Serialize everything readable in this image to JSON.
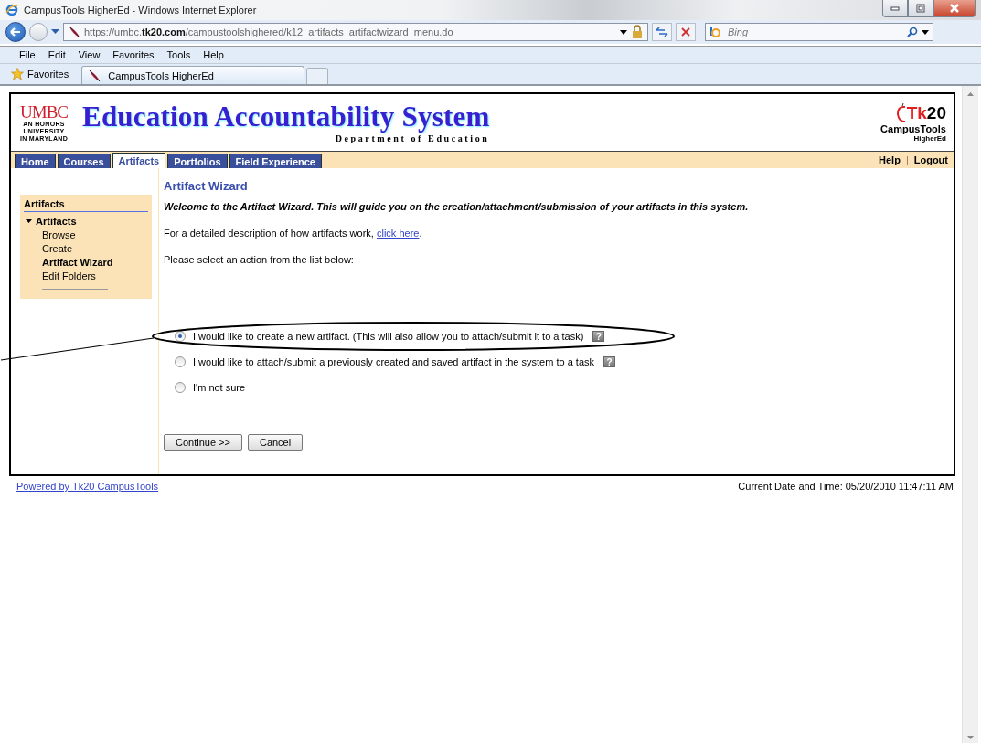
{
  "window": {
    "title": "CampusTools HigherEd - Windows Internet Explorer"
  },
  "address_bar": {
    "url": "https://umbc.**tk20.com**/campustoolshighered/k12_artifacts_artifactwizard_menu.do"
  },
  "search": {
    "placeholder": "Bing"
  },
  "menu": [
    "File",
    "Edit",
    "View",
    "Favorites",
    "Tools",
    "Help"
  ],
  "favorites_bar": {
    "label": "Favorites",
    "tab_title": "CampusTools HigherEd"
  },
  "header": {
    "logo": "UMBC",
    "logo_lines": [
      "AN HONORS",
      "UNIVERSITY",
      "IN MARYLAND"
    ],
    "title": "Education Accountability System",
    "subtitle": "Department of Education",
    "brand": "Tk20",
    "brand_name": "CampusTools",
    "brand_sub": "HigherEd"
  },
  "nav_tabs": [
    {
      "label": "Home",
      "selected": false
    },
    {
      "label": "Courses",
      "selected": false
    },
    {
      "label": "Artifacts",
      "selected": true
    },
    {
      "label": "Portfolios",
      "selected": false
    },
    {
      "label": "Field Experience",
      "selected": false
    }
  ],
  "nav_links": [
    "Help",
    "|",
    "Logout"
  ],
  "sidebar": {
    "heading": "Artifacts",
    "group": {
      "label": "Artifacts",
      "expanded": true,
      "items": [
        {
          "label": "Browse",
          "selected": false
        },
        {
          "label": "Create",
          "selected": false
        },
        {
          "label": "Artifact Wizard",
          "selected": true
        },
        {
          "label": "Edit Folders",
          "selected": false
        }
      ]
    }
  },
  "content": {
    "heading": "Artifact Wizard",
    "welcome": "Welcome to the Artifact Wizard. This will guide you on the creation/attachment/submission of your artifacts in this system.",
    "description": "For a detailed description of how artifacts work, ",
    "description_link": "click here",
    "description_end": ".",
    "prompt": "Please select an action from the list below:",
    "options": [
      {
        "label": "I would like to create a new artifact. (This will also allow you to attach/submit it to a task)",
        "selected": true,
        "help": "?",
        "circled": true
      },
      {
        "label": "I would like to attach/submit a previously created and saved artifact in the system to a task",
        "selected": false,
        "help": "?",
        "circled": false
      },
      {
        "label": "I'm not sure",
        "selected": false,
        "circled": false
      }
    ],
    "buttons": [
      "Continue >>",
      "Cancel"
    ]
  },
  "footer": {
    "link": "Powered by Tk20 CampusTools",
    "datetime": "Current Date and Time: 05/20/2010 11:47:11 AM"
  }
}
